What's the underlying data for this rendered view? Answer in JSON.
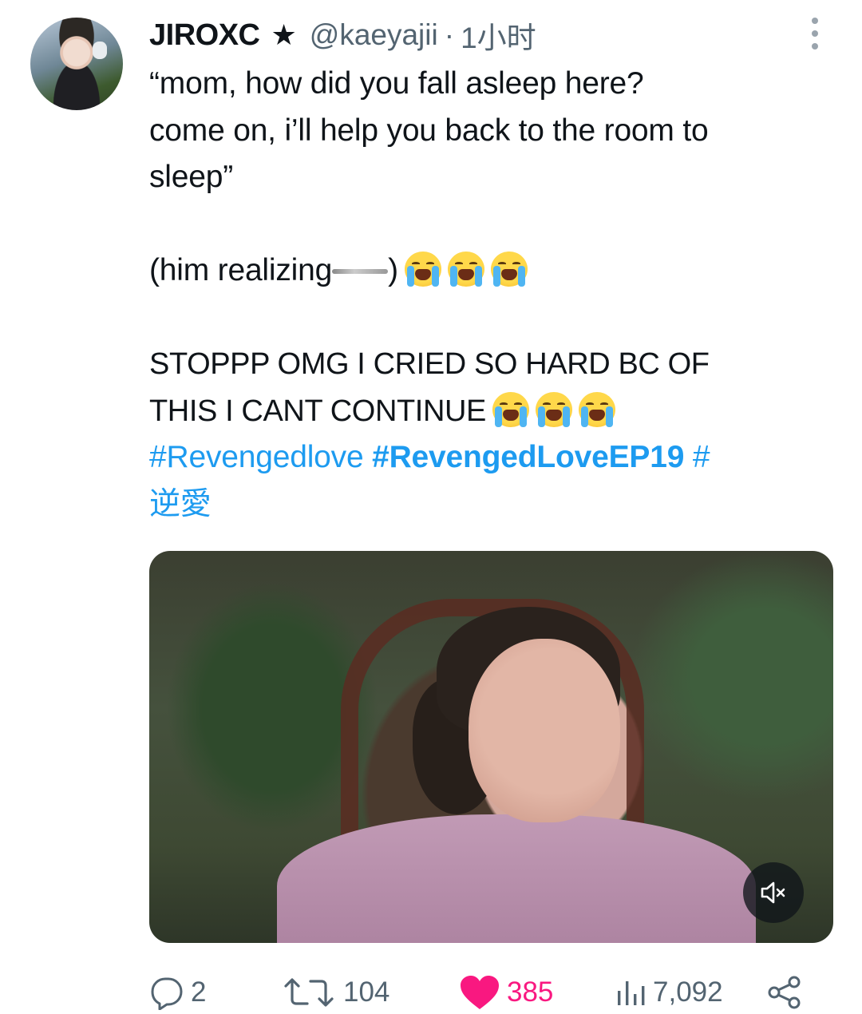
{
  "tweet": {
    "author": {
      "display_name": "JIROXC",
      "badge": "★",
      "handle": "@kaeyajii",
      "separator": "·",
      "time_ago": "1小时"
    },
    "text": {
      "line1": "“mom, how did you fall asleep here?",
      "line2": "come on, i’ll help you back to the room to",
      "line3": "sleep”",
      "line4_prefix": "(him realizing",
      "line4_suffix": ")",
      "line5": "STOPPP OMG I CRIED SO HARD BC OF",
      "line6": "THIS I CANT CONTINUE"
    },
    "hashtags": {
      "tag1": "#Revengedlove",
      "tag2": "#RevengedLoveEP19",
      "tag3a": "#",
      "tag3b": "逆愛"
    },
    "media": {
      "type": "video",
      "muted": true
    },
    "stats": {
      "replies": "2",
      "retweets": "104",
      "likes": "385",
      "views": "7,092"
    },
    "icons": {
      "more": "more-vertical-icon",
      "reply": "reply-icon",
      "retweet": "retweet-icon",
      "like": "heart-icon",
      "views": "views-icon",
      "share": "share-icon",
      "mute": "volume-muted-icon",
      "emoji": "loudly-crying-face"
    },
    "colors": {
      "link": "#1d9bf0",
      "like": "#f91880",
      "secondary_text": "#536471"
    }
  }
}
